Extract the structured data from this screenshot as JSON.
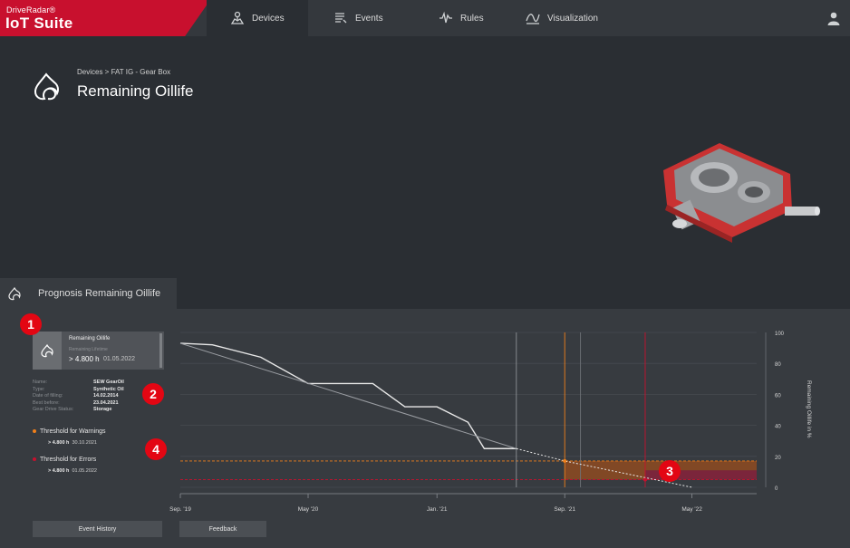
{
  "app": {
    "brand_top": "DriveRadar®",
    "brand_main": "IoT Suite",
    "tabs": [
      {
        "label": "Devices",
        "icon": "devices-icon",
        "active": true
      },
      {
        "label": "Events",
        "icon": "events-icon",
        "active": false
      },
      {
        "label": "Rules",
        "icon": "rules-icon",
        "active": false
      },
      {
        "label": "Visualization",
        "icon": "visualization-icon",
        "active": false
      }
    ],
    "user_icon": "user-icon"
  },
  "header": {
    "breadcrumb": "Devices  >  FAT IG - Gear Box",
    "title": "Remaining Oillife",
    "icon": "oil-drop-icon"
  },
  "panel": {
    "title": "Prognosis Remaining Oillife",
    "card": {
      "title": "Remaining Oillife",
      "sublabel": "Remaining Lifetime",
      "value": "> 4.800 h",
      "date": "01.05.2022"
    },
    "properties": [
      {
        "key": "Name:",
        "value": "SEW GearOil"
      },
      {
        "key": "Type:",
        "value": "Synthetic Oil"
      },
      {
        "key": "Date of filling:",
        "value": "14.02.2014"
      },
      {
        "key": "Best before:",
        "value": "23.04.2021"
      },
      {
        "key": "Gear Drive Status:",
        "value": "Storage"
      }
    ],
    "thresholds": {
      "warning": {
        "label": "Threshold for Warnings",
        "value": "> 4.800 h",
        "date": "30.10.2021",
        "color": "#f07f1a"
      },
      "error": {
        "label": "Threshold for Errors",
        "value": "> 4.800 h",
        "date": "01.05.2022",
        "color": "#c8102e"
      }
    },
    "buttons": {
      "event_history": "Event History",
      "feedback": "Feedback"
    }
  },
  "markers": [
    "1",
    "2",
    "3",
    "4"
  ],
  "colors": {
    "accent": "#c8102e",
    "warning": "#f07f1a",
    "background": "#2a2e33",
    "panel": "#373b40"
  },
  "chart_data": {
    "type": "line",
    "x_ticks": [
      "Sep. '19",
      "May '20",
      "Jan. '21",
      "Sep. '21",
      "May '22"
    ],
    "y_ticks": [
      0,
      20,
      40,
      60,
      80,
      100
    ],
    "ylabel": "Remaining Oillife in %",
    "ylim": [
      0,
      100
    ],
    "y_axis_side": "right",
    "series": [
      {
        "x": [
          "2019-09",
          "2019-11",
          "2020-02",
          "2020-05",
          "2020-08",
          "2020-09",
          "2020-11",
          "2021-01",
          "2021-03",
          "2021-04",
          "2021-06"
        ],
        "values": [
          93,
          92,
          84,
          67,
          67,
          67,
          52,
          52,
          42,
          25,
          25
        ]
      },
      {
        "x": [
          "2019-09",
          "2021-06"
        ],
        "values": [
          93,
          25
        ]
      },
      {
        "x": [
          "2021-06",
          "2021-09",
          "2022-05"
        ],
        "values": [
          25,
          17,
          0
        ]
      }
    ],
    "thresholds": [
      {
        "y": 17,
        "color": "#f07f1a"
      },
      {
        "y": 5,
        "color": "#c8102e"
      }
    ],
    "vertical_lines": [
      {
        "x": "2021-06",
        "color": "#8d9196"
      },
      {
        "x": "2021-09",
        "color": "#f07f1a"
      },
      {
        "x": "2021-10",
        "color": "#6e7277"
      },
      {
        "x": "2022-02",
        "color": "#c8102e"
      }
    ],
    "grid": true
  }
}
